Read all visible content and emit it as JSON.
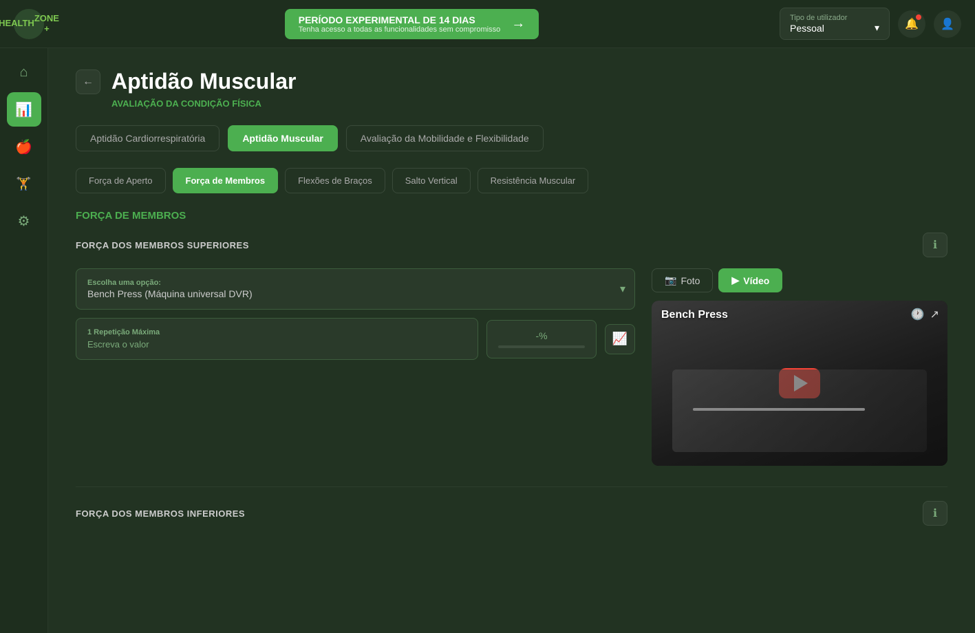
{
  "topNav": {
    "logo": {
      "line1": "HEALTH",
      "line2": "ZONE +"
    },
    "trialBanner": {
      "title": "PERÍODO EXPERIMENTAL DE 14 DIAS",
      "subtitle": "Tenha acesso a todas as funcionalidades sem compromisso",
      "arrow": "→"
    },
    "userType": {
      "label": "Tipo de utilizador",
      "value": "Pessoal",
      "chevron": "▾"
    },
    "notificationIcon": "🔔",
    "profileIcon": "👤"
  },
  "sidebar": {
    "items": [
      {
        "name": "home",
        "icon": "⌂",
        "active": false
      },
      {
        "name": "chart",
        "icon": "📊",
        "active": true
      },
      {
        "name": "nutrition",
        "icon": "🍎",
        "active": false
      },
      {
        "name": "activity",
        "icon": "🏋",
        "active": false
      },
      {
        "name": "settings",
        "icon": "⚙",
        "active": false
      }
    ]
  },
  "page": {
    "backButton": "←",
    "title": "Aptidão Muscular",
    "subtitle": "AVALIAÇÃO DA CONDIÇÃO FÍSICA"
  },
  "mainTabs": [
    {
      "label": "Aptidão Cardiorrespiratória",
      "active": false
    },
    {
      "label": "Aptidão Muscular",
      "active": true
    },
    {
      "label": "Avaliação da Mobilidade e Flexibilidade",
      "active": false
    }
  ],
  "subTabs": [
    {
      "label": "Força de Aperto",
      "active": false
    },
    {
      "label": "Força de Membros",
      "active": true
    },
    {
      "label": "Flexões de Braços",
      "active": false
    },
    {
      "label": "Salto Vertical",
      "active": false
    },
    {
      "label": "Resistência Muscular",
      "active": false
    }
  ],
  "sectionTitle": "FORÇA DE MEMBROS",
  "upperSection": {
    "title": "FORÇA DOS MEMBROS SUPERIORES",
    "selectLabel": "Escolha uma opção:",
    "selectValue": "Bench Press (Máquina universal DVR)",
    "inputLabel": "1 Repetição Máxima",
    "inputPlaceholder": "Escreva o valor",
    "percentValue": "-%",
    "mediaButtons": [
      {
        "label": "Foto",
        "icon": "📷",
        "active": false
      },
      {
        "label": "Vídeo",
        "icon": "▶",
        "active": true
      }
    ],
    "video": {
      "title": "Bench Press",
      "timeIcon": "🕐",
      "shareIcon": "↗"
    }
  },
  "lowerSection": {
    "title": "FORÇA DOS MEMBROS INFERIORES"
  }
}
